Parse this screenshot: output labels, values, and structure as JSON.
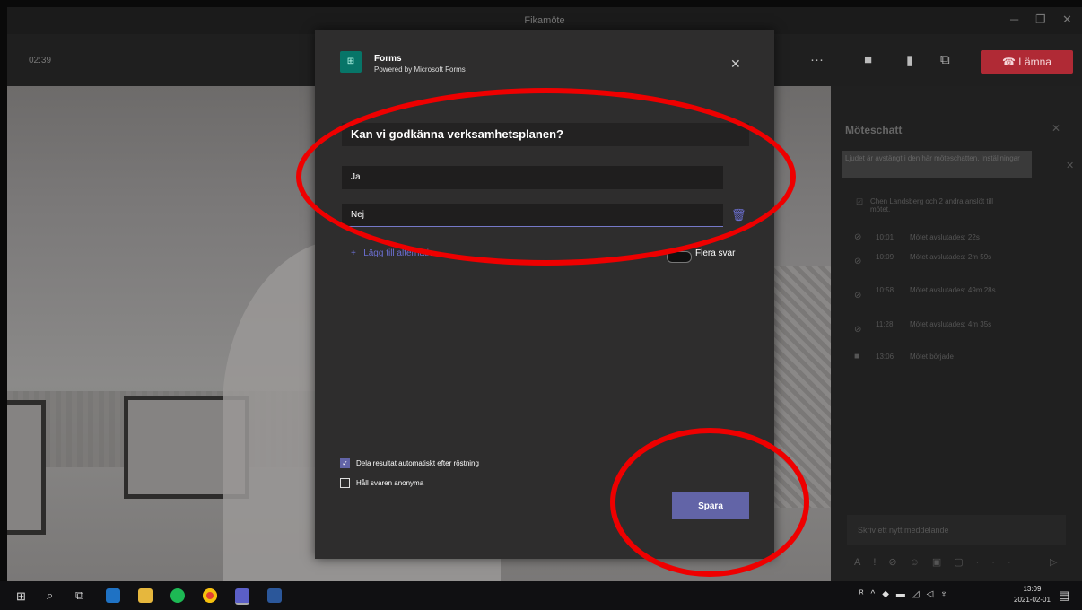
{
  "window": {
    "title": "Fikamöte"
  },
  "meeting": {
    "elapsed": "02:39",
    "leave_label": "Lämna"
  },
  "chat": {
    "title": "Möteschatt",
    "banner": "Ljudet är avstängt i den här möteschatten. Inställningar",
    "events": [
      {
        "time": "",
        "text": "Chen Landsberg och 2 andra anslöt till mötet."
      },
      {
        "time": "10:01",
        "text": "Mötet avslutades: 22s"
      },
      {
        "time": "10:09",
        "text": "Mötet avslutades: 2m 59s"
      },
      {
        "time": "10:58",
        "text": "Mötet avslutades: 49m 28s"
      },
      {
        "time": "11:28",
        "text": "Mötet avslutades: 4m 35s"
      },
      {
        "time": "13:06",
        "text": "Mötet började"
      }
    ],
    "compose_placeholder": "Skriv ett nytt meddelande"
  },
  "dialog": {
    "app_name": "Forms",
    "app_subtitle": "Powered by Microsoft Forms",
    "question": "Kan vi godkänna verksamhetsplanen?",
    "options": [
      "Ja",
      "Nej"
    ],
    "add_option_label": "Lägg till alternativ",
    "multi_answer_label": "Flera svar",
    "share_results_label": "Dela resultat automatiskt efter röstning",
    "share_results_checked": true,
    "anonymous_label": "Håll svaren anonyma",
    "anonymous_checked": false,
    "save_label": "Spara"
  },
  "taskbar": {
    "time": "13:09",
    "date": "2021-02-01"
  },
  "colors": {
    "accent": "#6264a7",
    "leave": "#b02a35",
    "annotation": "#ee0000"
  }
}
